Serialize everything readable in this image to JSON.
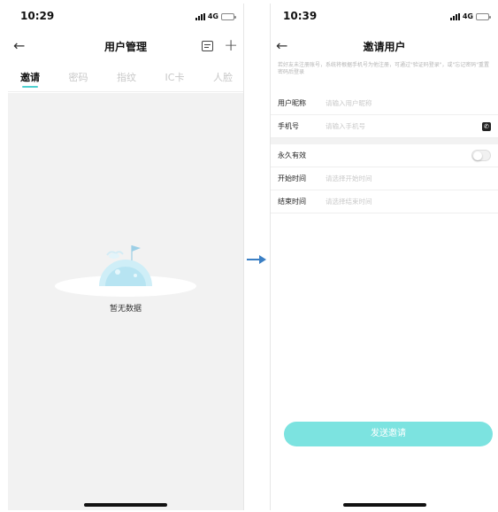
{
  "left_screen": {
    "status": {
      "time": "10:29",
      "network": "4G"
    },
    "nav": {
      "title": "用户管理",
      "back_icon": "arrow-left-icon",
      "card_icon": "id-card-icon",
      "add_icon": "plus-icon"
    },
    "tabs": [
      {
        "label": "邀请",
        "active": true
      },
      {
        "label": "密码",
        "active": false
      },
      {
        "label": "指纹",
        "active": false
      },
      {
        "label": "IC卡",
        "active": false
      },
      {
        "label": "人脸",
        "active": false
      }
    ],
    "empty_state": {
      "text": "暂无数据",
      "icon": "empty-moon-flag-illustration"
    }
  },
  "right_screen": {
    "status": {
      "time": "10:39",
      "network": "4G"
    },
    "nav": {
      "title": "邀请用户",
      "back_icon": "arrow-left-icon"
    },
    "hint": "若好友未注册账号，系统将根据手机号为他注册，可通过\"验证码登录\"，或\"忘记密码\"重置密码后登录",
    "form": {
      "nickname": {
        "label": "用户昵称",
        "placeholder": "请输入用户昵称"
      },
      "phone": {
        "label": "手机号",
        "placeholder": "请输入手机号",
        "icon": "phone-book-icon"
      },
      "permanent": {
        "label": "永久有效",
        "enabled": false
      },
      "start_time": {
        "label": "开始时间",
        "placeholder": "请选择开始时间"
      },
      "end_time": {
        "label": "结束时间",
        "placeholder": "请选择结束时间"
      }
    },
    "send_button": "发送邀请"
  },
  "colors": {
    "accent": "#4fd0cf",
    "button": "#7ce3e0",
    "arrow": "#3b7fc4",
    "background_grey": "#f2f2f2"
  }
}
